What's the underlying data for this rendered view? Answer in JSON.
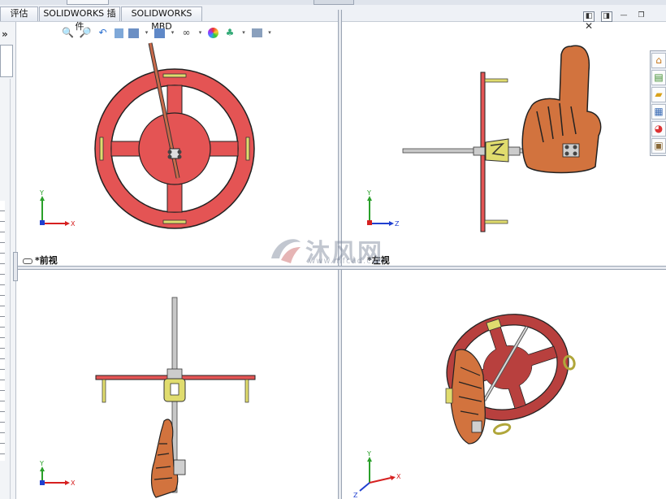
{
  "tabs": [
    {
      "label": "评估"
    },
    {
      "label": "SOLIDWORKS 插件"
    },
    {
      "label": "SOLIDWORKS MBD"
    }
  ],
  "left_panel": {
    "collapse_glyph": "»"
  },
  "viewports": [
    {
      "label": "*前视",
      "triad": {
        "up": "Y",
        "right": "X"
      }
    },
    {
      "label": "*左视",
      "triad": {
        "up": "Y",
        "right": "Z"
      }
    },
    {
      "label": "",
      "triad": {
        "up": "Y",
        "right": "X"
      }
    },
    {
      "label": "",
      "triad": {
        "up": "Y",
        "right": "X",
        "diag": "Z"
      }
    }
  ],
  "hud_icons": [
    "zoom-to-fit-icon",
    "zoom-area-icon",
    "previous-view-icon",
    "section-view-icon",
    "view-orientation-icon",
    "display-style-icon",
    "hide-show-items-icon",
    "edit-appearance-icon",
    "apply-scene-icon",
    "view-settings-icon"
  ],
  "window_controls": [
    "tile-left-icon",
    "tile-right-icon",
    "minimize-icon",
    "restore-icon",
    "close-icon"
  ],
  "task_pane_icons": [
    "home-icon",
    "design-library-icon",
    "file-explorer-icon",
    "view-palette-icon",
    "appearances-icon",
    "custom-properties-icon"
  ],
  "watermark": {
    "text": "沐风网",
    "url": "www.mfcad.com"
  },
  "colors": {
    "wheel": "#e45454",
    "outline": "#222222",
    "hand": "#d2733e",
    "bracket": "#e0dc6e",
    "rod": "#b5b5b5",
    "axis_x": "#d62020",
    "axis_y": "#2aa02a",
    "axis_z": "#2040d0"
  }
}
